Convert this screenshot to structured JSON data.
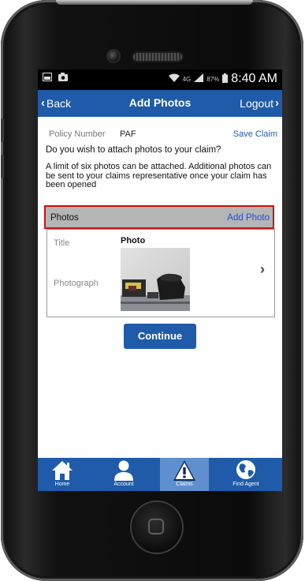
{
  "status_bar": {
    "battery": "87%",
    "time": "8:40 AM"
  },
  "nav": {
    "back": "Back",
    "title": "Add Photos",
    "logout": "Logout"
  },
  "policy": {
    "label": "Policy Number",
    "value": "PAF",
    "save_claim": "Save Claim"
  },
  "question": "Do you wish to attach photos to your claim?",
  "limit_text": "A limit of six photos can be attached. Additional photos can be sent to your claims representative once your claim has been opened",
  "photos_section": {
    "label": "Photos",
    "add_photo": "Add Photo"
  },
  "photo_entry": {
    "title_label": "Title",
    "title_value": "Photo",
    "photograph_label": "Photograph"
  },
  "continue_label": "Continue",
  "tabs": [
    {
      "label": "Home",
      "icon": "home-icon"
    },
    {
      "label": "Account",
      "icon": "person-icon"
    },
    {
      "label": "Claims",
      "icon": "warning-icon",
      "active": true
    },
    {
      "label": "Find Agent",
      "icon": "globe-icon"
    }
  ],
  "colors": {
    "primary": "#1f5ba8",
    "highlight": "#d01010",
    "link": "#1f4fd6"
  }
}
